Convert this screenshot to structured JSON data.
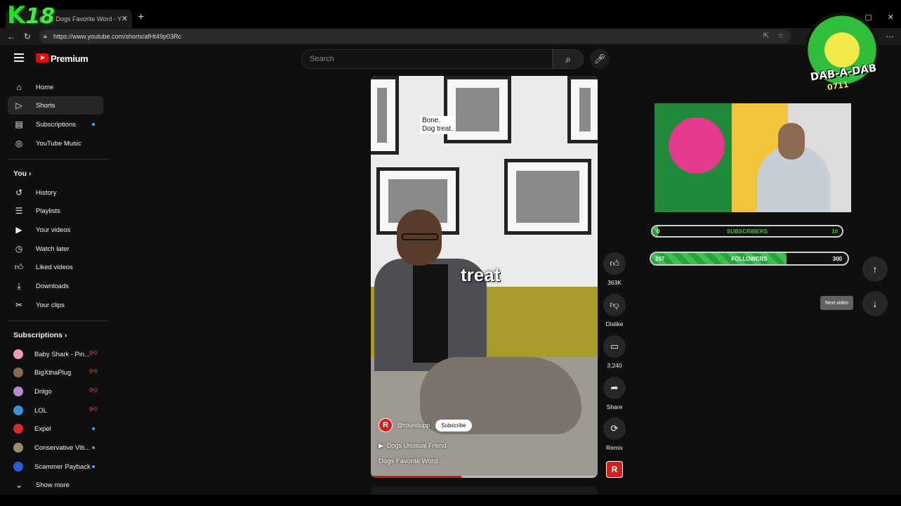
{
  "browser": {
    "tab_title": "(265) Dogs Favorite Word - Y",
    "url": "https://www.youtube.com/shorts/afHt49p03Rc"
  },
  "overlay": {
    "k18_letter": "K",
    "k18_number": "18",
    "dab_logo_text": "DAB-A-DAB",
    "dab_logo_sub": "0711",
    "subscribers_label": "SUBSCRIBERS",
    "subscribers_current": "0",
    "subscribers_goal": "10",
    "subscribers_progress": 0.03,
    "followers_label": "FOLLOWERS",
    "followers_current": "207",
    "followers_goal": "300",
    "followers_progress": 0.69,
    "accent_color": "#3cc24f"
  },
  "header": {
    "brand": "Premium",
    "search_placeholder": "Search"
  },
  "sidebar": {
    "main_items": [
      {
        "label": "Home",
        "icon": "home-icon"
      },
      {
        "label": "Shorts",
        "icon": "shorts-icon"
      },
      {
        "label": "Subscriptions",
        "icon": "subscriptions-icon"
      },
      {
        "label": "YouTube Music",
        "icon": "music-icon"
      }
    ],
    "you_section": "You",
    "you_items": [
      {
        "label": "History",
        "icon": "history-icon"
      },
      {
        "label": "Playlists",
        "icon": "playlists-icon"
      },
      {
        "label": "Your videos",
        "icon": "your-videos-icon"
      },
      {
        "label": "Watch later",
        "icon": "watch-later-icon"
      },
      {
        "label": "Liked videos",
        "icon": "liked-videos-icon"
      },
      {
        "label": "Downloads",
        "icon": "downloads-icon"
      },
      {
        "label": "Your clips",
        "icon": "clips-icon"
      }
    ],
    "subscriptions_section": "Subscriptions",
    "subscriptions": [
      {
        "label": "Baby Shark - Pin...",
        "status": "live",
        "color": "#f29bb5"
      },
      {
        "label": "BigXthaPlug",
        "status": "live",
        "color": "#8a6a4a"
      },
      {
        "label": "Drilgo",
        "status": "live",
        "color": "#b58ad4"
      },
      {
        "label": "LOL",
        "status": "live",
        "color": "#3a8fd9"
      },
      {
        "label": "Expel",
        "status": "new",
        "color": "#d92b2b"
      },
      {
        "label": "Conservative Vib...",
        "status": "new",
        "color": "#9a8a6a"
      },
      {
        "label": "Scammer Payback",
        "status": "new",
        "color": "#2b5fd9"
      }
    ],
    "show_more": "Show more"
  },
  "short": {
    "caption_top_line1": "Bone.",
    "caption_top_line2": "Dog treat.",
    "caption_big": "treat",
    "channel_initial": "R",
    "channel_handle": "@roundupp",
    "subscribe_label": "Subscribe",
    "playlist_label": "Dogs Unusual Friend",
    "title": "Dogs Favorite Word",
    "progress": 0.4
  },
  "actions": {
    "like_count": "363K",
    "dislike_label": "Dislike",
    "comment_count": "3,240",
    "share_label": "Share",
    "remix_label": "Remix",
    "remix_badge": "R"
  },
  "navigation": {
    "next_tooltip": "Next video"
  }
}
